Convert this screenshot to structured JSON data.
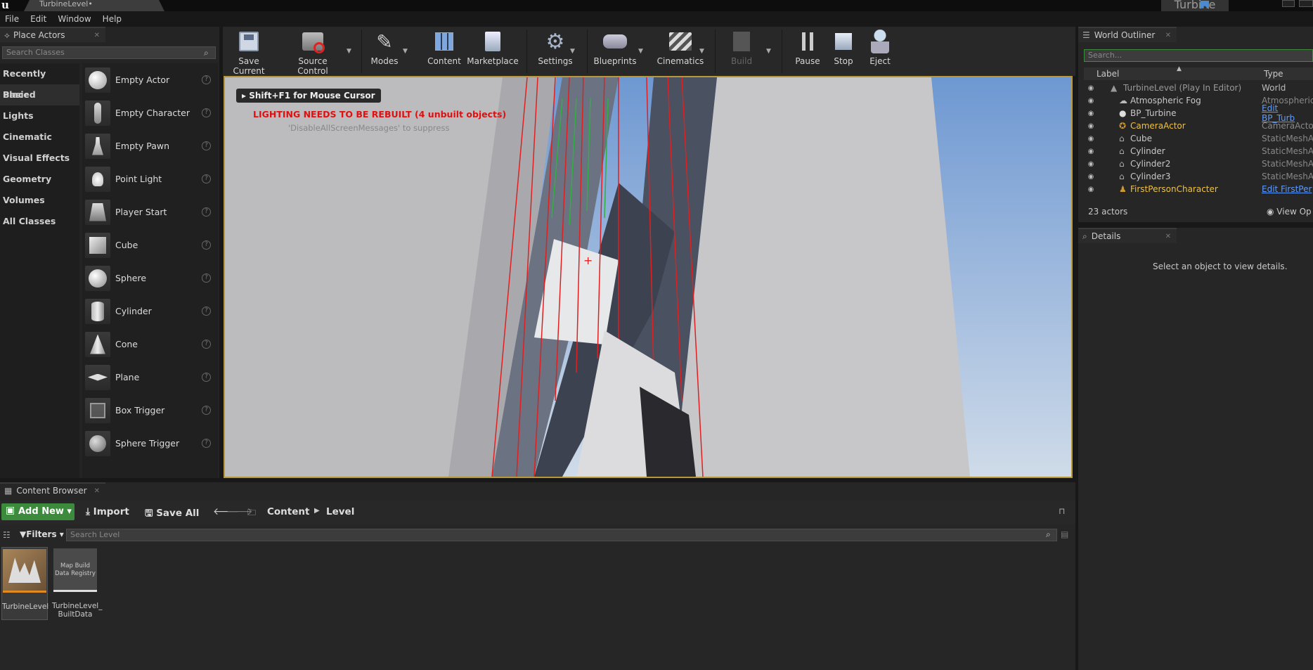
{
  "window": {
    "doc_tab": "TurbineLevel•",
    "project": "Turbine"
  },
  "menu": [
    "File",
    "Edit",
    "Window",
    "Help"
  ],
  "place_actors": {
    "tab": "Place Actors",
    "search_placeholder": "Search Classes",
    "categories": [
      "Recently Placed",
      "Basic",
      "Lights",
      "Cinematic",
      "Visual Effects",
      "Geometry",
      "Volumes",
      "All Classes"
    ],
    "selected_category": "Basic",
    "items": [
      "Empty Actor",
      "Empty Character",
      "Empty Pawn",
      "Point Light",
      "Player Start",
      "Cube",
      "Sphere",
      "Cylinder",
      "Cone",
      "Plane",
      "Box Trigger",
      "Sphere Trigger"
    ]
  },
  "toolbar": {
    "save_current": "Save Current",
    "source_control": "Source Control",
    "modes": "Modes",
    "content": "Content",
    "marketplace": "Marketplace",
    "settings": "Settings",
    "blueprints": "Blueprints",
    "cinematics": "Cinematics",
    "build": "Build",
    "pause": "Pause",
    "stop": "Stop",
    "eject": "Eject"
  },
  "viewport": {
    "hint": "Shift+F1 for Mouse Cursor",
    "warning": "LIGHTING NEEDS TO BE REBUILT (4 unbuilt objects)",
    "suppress": "'DisableAllScreenMessages' to suppress"
  },
  "outliner": {
    "tab": "World Outliner",
    "search_placeholder": "Search...",
    "col_label": "Label",
    "col_type": "Type",
    "rows": [
      {
        "label": "TurbineLevel (Play In Editor)",
        "type": "World"
      },
      {
        "label": "Atmospheric Fog",
        "type": "AtmosphericF"
      },
      {
        "label": "BP_Turbine",
        "type": "Edit BP_Turb"
      },
      {
        "label": "CameraActor",
        "type": "CameraActor"
      },
      {
        "label": "Cube",
        "type": "StaticMeshAc"
      },
      {
        "label": "Cylinder",
        "type": "StaticMeshAc"
      },
      {
        "label": "Cylinder2",
        "type": "StaticMeshAc"
      },
      {
        "label": "Cylinder3",
        "type": "StaticMeshAc"
      },
      {
        "label": "FirstPersonCharacter",
        "type": "Edit FirstPer"
      }
    ],
    "count": "23 actors",
    "view_options": "View Op"
  },
  "details": {
    "tab": "Details",
    "empty": "Select an object to view details."
  },
  "content_browser": {
    "tab": "Content Browser",
    "add_new": "Add New",
    "import": "Import",
    "save_all": "Save All",
    "path": [
      "Content",
      "Level"
    ],
    "filters": "Filters",
    "search_placeholder": "Search Level",
    "assets": [
      {
        "name": "TurbineLevel",
        "thumb_text": ""
      },
      {
        "name": "TurbineLevel_ BuiltData",
        "thumb_text": "Map Build Data Registry"
      }
    ]
  },
  "colors": {
    "accent_green": "#3c8a3c",
    "viewport_border": "#b8963a",
    "warning_red": "#e01010",
    "link_blue": "#5b9bff",
    "highlight_yellow": "#f0c040"
  }
}
